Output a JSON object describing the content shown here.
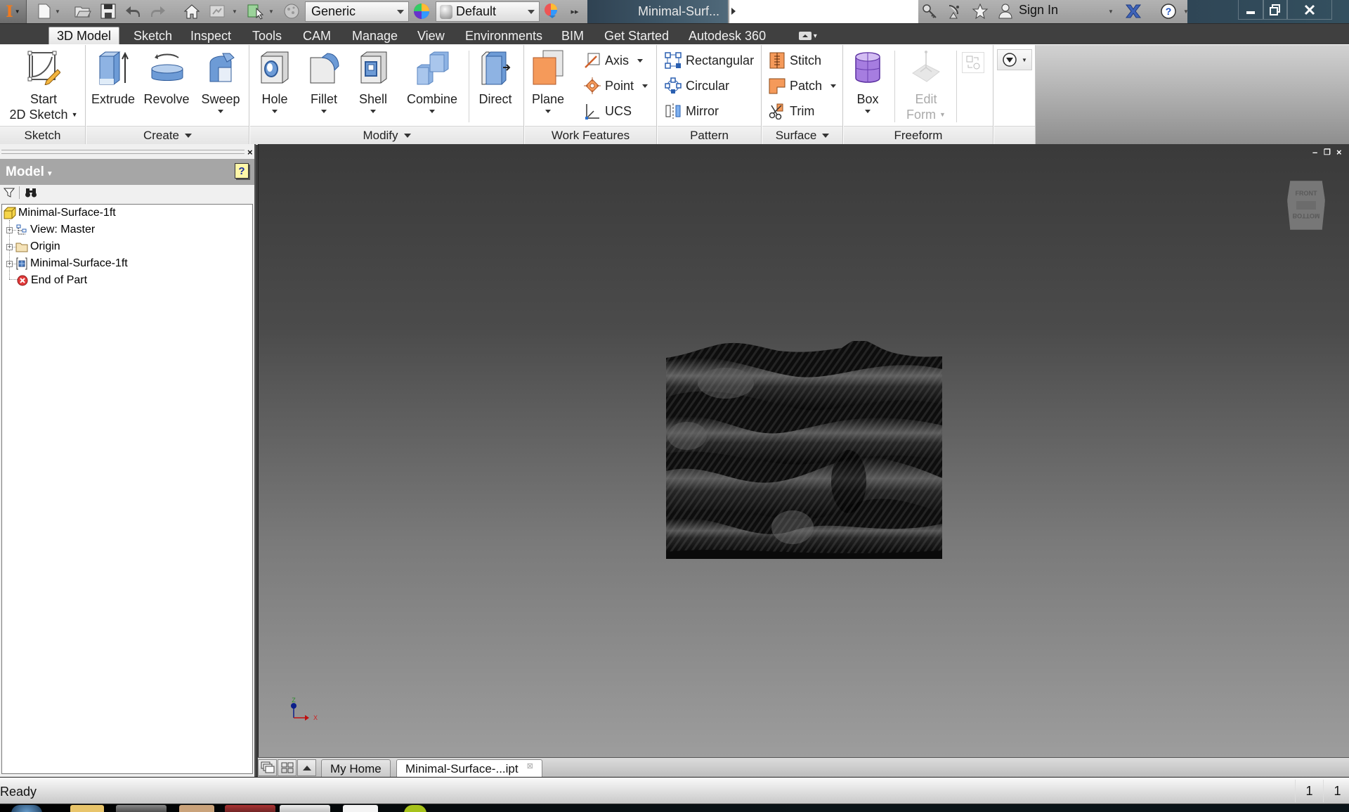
{
  "qat": {
    "app_menu_icon": "inventor-logo-icon",
    "icons": [
      "new-file-icon",
      "open-folder-icon",
      "save-icon",
      "undo-icon",
      "redo-icon",
      "home-icon",
      "update-icon",
      "select-icon",
      "material-icon"
    ],
    "material_combo": "Generic",
    "appearance_combo": "Default",
    "document_title": "Minimal-Surf...",
    "search_placeholder": "",
    "sign_in": "Sign In",
    "help_icon": "help-icon"
  },
  "ribbon_tabs": [
    {
      "label": "3D Model",
      "active": true
    },
    {
      "label": "Sketch"
    },
    {
      "label": "Inspect"
    },
    {
      "label": "Tools"
    },
    {
      "label": "CAM"
    },
    {
      "label": "Manage"
    },
    {
      "label": "View"
    },
    {
      "label": "Environments"
    },
    {
      "label": "BIM"
    },
    {
      "label": "Get Started"
    },
    {
      "label": "Autodesk 360"
    }
  ],
  "ribbon": {
    "groups": {
      "sketch": {
        "label": "Sketch",
        "start_line1": "Start",
        "start_line2": "2D Sketch"
      },
      "create": {
        "label": "Create",
        "extrude": "Extrude",
        "revolve": "Revolve",
        "sweep": "Sweep"
      },
      "modify": {
        "label": "Modify",
        "hole": "Hole",
        "fillet": "Fillet",
        "shell": "Shell",
        "combine": "Combine",
        "direct": "Direct"
      },
      "work_features": {
        "label": "Work Features",
        "plane": "Plane",
        "axis": "Axis",
        "point": "Point",
        "ucs": "UCS"
      },
      "pattern": {
        "label": "Pattern",
        "rectangular": "Rectangular",
        "circular": "Circular",
        "mirror": "Mirror"
      },
      "surface": {
        "label": "Surface",
        "stitch": "Stitch",
        "patch": "Patch",
        "trim": "Trim"
      },
      "freeform": {
        "label": "Freeform",
        "box": "Box",
        "edit_line1": "Edit",
        "edit_line2": "Form"
      }
    }
  },
  "browser": {
    "title": "Model",
    "tree": [
      {
        "label": "Minimal-Surface-1ft",
        "icon": "part-icon",
        "level": 0
      },
      {
        "label": "View: Master",
        "icon": "view-rep-icon",
        "level": 1,
        "expandable": true
      },
      {
        "label": "Origin",
        "icon": "folder-icon",
        "level": 1,
        "expandable": true
      },
      {
        "label": "Minimal-Surface-1ft",
        "icon": "surface-body-icon",
        "level": 1,
        "expandable": true
      },
      {
        "label": "End of Part",
        "icon": "end-of-part-icon",
        "level": 1
      }
    ]
  },
  "viewport": {
    "viewcube_front": "FRONT",
    "viewcube_bottom": "BOTTOM",
    "triad_z": "Z",
    "triad_x": "X"
  },
  "doc_tabs": [
    {
      "label": "My Home",
      "active": false
    },
    {
      "label": "Minimal-Surface-...ipt",
      "active": true
    }
  ],
  "status": {
    "message": "Ready",
    "count1": "1",
    "count2": "1"
  }
}
